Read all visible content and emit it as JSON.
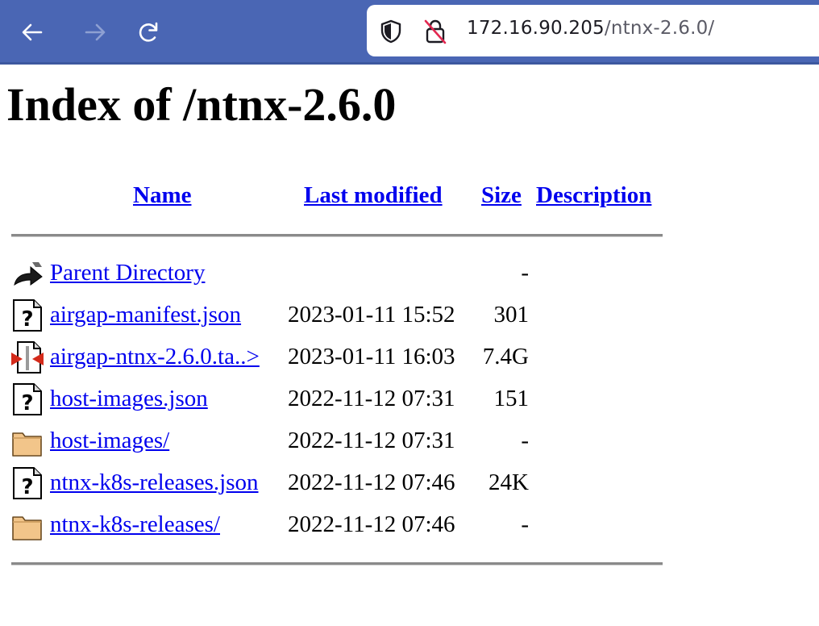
{
  "browser": {
    "url_host": "172.16.90.205",
    "url_path": "/ntnx-2.6.0/"
  },
  "page": {
    "title": "Index of /ntnx-2.6.0"
  },
  "table": {
    "headers": {
      "name": "Name",
      "last_modified": "Last modified",
      "size": "Size",
      "description": "Description"
    },
    "rows": [
      {
        "icon": "back-arrow-icon",
        "name": "Parent Directory",
        "modified": "",
        "size": "-"
      },
      {
        "icon": "unknown-file-icon",
        "name": "airgap-manifest.json",
        "modified": "2023-01-11 15:52",
        "size": "301"
      },
      {
        "icon": "archive-file-icon",
        "name": "airgap-ntnx-2.6.0.ta..>",
        "modified": "2023-01-11 16:03",
        "size": "7.4G"
      },
      {
        "icon": "unknown-file-icon",
        "name": "host-images.json",
        "modified": "2022-11-12 07:31",
        "size": "151"
      },
      {
        "icon": "folder-icon",
        "name": "host-images/",
        "modified": "2022-11-12 07:31",
        "size": "-"
      },
      {
        "icon": "unknown-file-icon",
        "name": "ntnx-k8s-releases.json",
        "modified": "2022-11-12 07:46",
        "size": "24K"
      },
      {
        "icon": "folder-icon",
        "name": "ntnx-k8s-releases/",
        "modified": "2022-11-12 07:46",
        "size": "-"
      }
    ]
  },
  "colors": {
    "toolbar": "#4a66b4",
    "link": "#0000ee"
  }
}
